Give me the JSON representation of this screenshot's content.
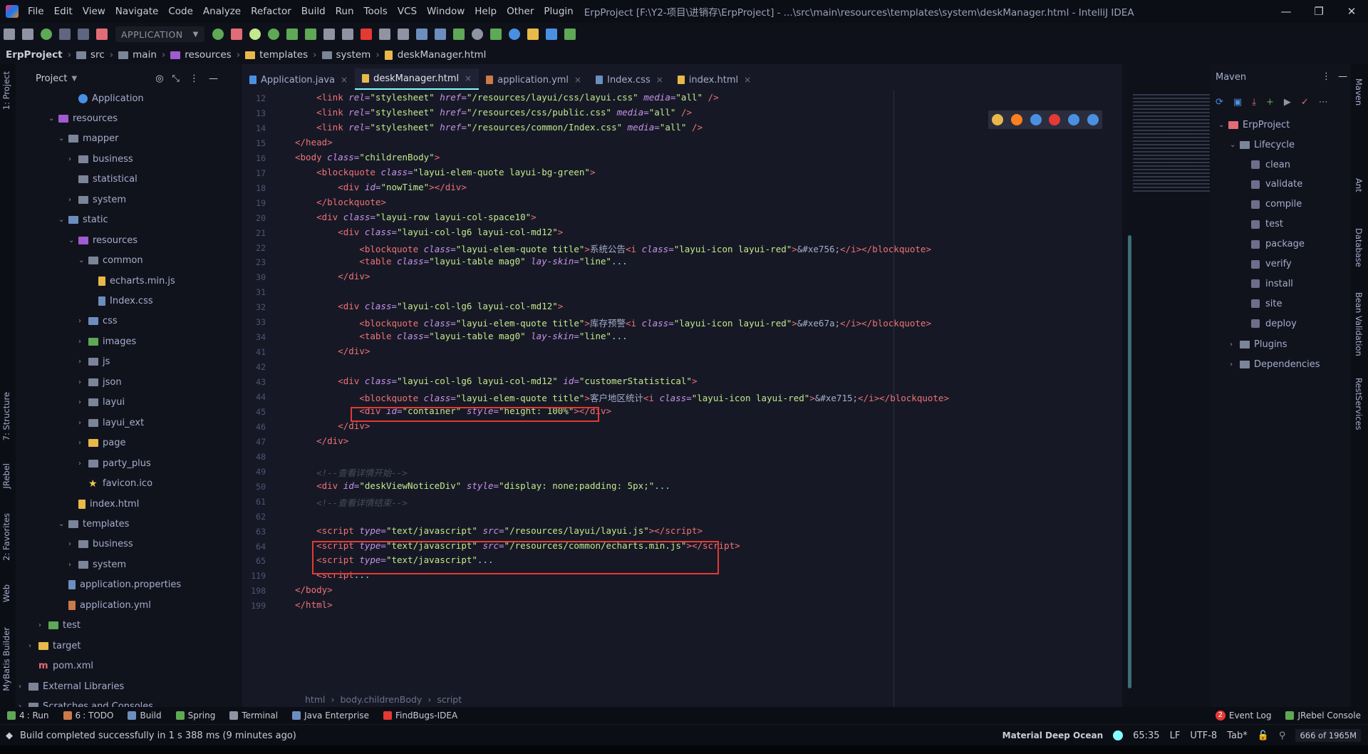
{
  "window": {
    "title": "ErpProject [F:\\Y2-项目\\进销存\\ErpProject] - ...\\src\\main\\resources\\templates\\system\\deskManager.html - IntelliJ IDEA",
    "minimize": "—",
    "maximize": "❐",
    "close": "✕"
  },
  "menu": [
    "File",
    "Edit",
    "View",
    "Navigate",
    "Code",
    "Analyze",
    "Refactor",
    "Build",
    "Run",
    "Tools",
    "VCS",
    "Window",
    "Help",
    "Other",
    "Plugin"
  ],
  "toolbar": {
    "run_config": "APPLICATION"
  },
  "breadcrumb": [
    "ErpProject",
    "src",
    "main",
    "resources",
    "templates",
    "system",
    "deskManager.html"
  ],
  "left_stripe": {
    "project": "1: Project",
    "structure": "7: Structure",
    "jrebel": "JRebel",
    "favorites": "2: Favorites",
    "web": "Web",
    "mybatis": "MyBatis Builder"
  },
  "project_panel": {
    "label": "Project",
    "tree": [
      {
        "label": "Application",
        "icon": "class",
        "indent": 5,
        "arrow": ""
      },
      {
        "label": "resources",
        "icon": "res",
        "indent": 3,
        "arrow": "⌄"
      },
      {
        "label": "mapper",
        "icon": "folder",
        "indent": 4,
        "arrow": "⌄"
      },
      {
        "label": "business",
        "icon": "folder",
        "indent": 5,
        "arrow": "›"
      },
      {
        "label": "statistical",
        "icon": "folder",
        "indent": 5,
        "arrow": ""
      },
      {
        "label": "system",
        "icon": "folder",
        "indent": 5,
        "arrow": "›"
      },
      {
        "label": "static",
        "icon": "src",
        "indent": 4,
        "arrow": "⌄"
      },
      {
        "label": "resources",
        "icon": "res",
        "indent": 5,
        "arrow": "⌄"
      },
      {
        "label": "common",
        "icon": "folder",
        "indent": 6,
        "arrow": "⌄"
      },
      {
        "label": "echarts.min.js",
        "icon": "js",
        "indent": 7,
        "arrow": ""
      },
      {
        "label": "Index.css",
        "icon": "css",
        "indent": 7,
        "arrow": ""
      },
      {
        "label": "css",
        "icon": "src",
        "indent": 6,
        "arrow": "›"
      },
      {
        "label": "images",
        "icon": "test",
        "indent": 6,
        "arrow": "›"
      },
      {
        "label": "js",
        "icon": "folder",
        "indent": 6,
        "arrow": "›"
      },
      {
        "label": "json",
        "icon": "folder",
        "indent": 6,
        "arrow": "›"
      },
      {
        "label": "layui",
        "icon": "folder",
        "indent": 6,
        "arrow": "›"
      },
      {
        "label": "layui_ext",
        "icon": "folder",
        "indent": 6,
        "arrow": "›"
      },
      {
        "label": "page",
        "icon": "page",
        "indent": 6,
        "arrow": "›"
      },
      {
        "label": "party_plus",
        "icon": "folder",
        "indent": 6,
        "arrow": "›"
      },
      {
        "label": "favicon.ico",
        "icon": "star",
        "indent": 6,
        "arrow": ""
      },
      {
        "label": "index.html",
        "icon": "htm",
        "indent": 5,
        "arrow": ""
      },
      {
        "label": "templates",
        "icon": "folder",
        "indent": 4,
        "arrow": "⌄"
      },
      {
        "label": "business",
        "icon": "folder",
        "indent": 5,
        "arrow": "›"
      },
      {
        "label": "system",
        "icon": "folder",
        "indent": 5,
        "arrow": "›"
      },
      {
        "label": "application.properties",
        "icon": "prop",
        "indent": 4,
        "arrow": ""
      },
      {
        "label": "application.yml",
        "icon": "yml",
        "indent": 4,
        "arrow": ""
      },
      {
        "label": "test",
        "icon": "test",
        "indent": 2,
        "arrow": "›"
      },
      {
        "label": "target",
        "icon": "page",
        "indent": 1,
        "arrow": "›"
      },
      {
        "label": "pom.xml",
        "icon": "pom",
        "indent": 1,
        "arrow": ""
      },
      {
        "label": "External Libraries",
        "icon": "lib",
        "indent": 0,
        "arrow": "›"
      },
      {
        "label": "Scratches and Consoles",
        "icon": "lib",
        "indent": 0,
        "arrow": "›"
      }
    ]
  },
  "editor_tabs": [
    {
      "label": "Application.java",
      "color": "#4a90e2",
      "active": false
    },
    {
      "label": "deskManager.html",
      "color": "#e8b94a",
      "active": true
    },
    {
      "label": "application.yml",
      "color": "#cb7a4a",
      "active": false
    },
    {
      "label": "Index.css",
      "color": "#6c8ebf",
      "active": false
    },
    {
      "label": "index.html",
      "color": "#e8b94a",
      "active": false
    }
  ],
  "code_lines": [
    {
      "n": "12",
      "html": "    <span class=\"tag\">&lt;link</span> <span class=\"attr\">rel=</span><span class=\"str\">\"stylesheet\"</span> <span class=\"attr\">href=</span><span class=\"str\">\"/resources/layui/css/layui.css\"</span> <span class=\"attr\">media=</span><span class=\"str\">\"all\"</span> <span class=\"tag\">/&gt;</span>"
    },
    {
      "n": "13",
      "html": "    <span class=\"tag\">&lt;link</span> <span class=\"attr\">rel=</span><span class=\"str\">\"stylesheet\"</span> <span class=\"attr\">href=</span><span class=\"str\">\"/resources/css/public.css\"</span> <span class=\"attr\">media=</span><span class=\"str\">\"all\"</span> <span class=\"tag\">/&gt;</span>"
    },
    {
      "n": "14",
      "html": "    <span class=\"tag\">&lt;link</span> <span class=\"attr\">rel=</span><span class=\"str\">\"stylesheet\"</span> <span class=\"attr\">href=</span><span class=\"str\">\"/resources/common/Index.css\"</span> <span class=\"attr\">media=</span><span class=\"str\">\"all\"</span> <span class=\"tag\">/&gt;</span>"
    },
    {
      "n": "15",
      "html": "<span class=\"tag\">&lt;/head&gt;</span>"
    },
    {
      "n": "16",
      "html": "<span class=\"tag\">&lt;body</span> <span class=\"attr\">class=</span><span class=\"str\">\"childrenBody\"</span><span class=\"tag\">&gt;</span>"
    },
    {
      "n": "17",
      "html": "    <span class=\"tag\">&lt;blockquote</span> <span class=\"attr\">class=</span><span class=\"str\">\"layui-elem-quote layui-bg-green\"</span><span class=\"tag\">&gt;</span>"
    },
    {
      "n": "18",
      "html": "        <span class=\"tag\">&lt;div</span> <span class=\"attr\">id=</span><span class=\"str\">\"nowTime\"</span><span class=\"tag\">&gt;&lt;/div&gt;</span>"
    },
    {
      "n": "19",
      "html": "    <span class=\"tag\">&lt;/blockquote&gt;</span>"
    },
    {
      "n": "20",
      "html": "    <span class=\"tag\">&lt;div</span> <span class=\"attr\">class=</span><span class=\"str\">\"layui-row layui-col-space10\"</span><span class=\"tag\">&gt;</span>"
    },
    {
      "n": "21",
      "html": "        <span class=\"tag\">&lt;div</span> <span class=\"attr\">class=</span><span class=\"str\">\"layui-col-lg6 layui-col-md12\"</span><span class=\"tag\">&gt;</span>"
    },
    {
      "n": "22",
      "html": "            <span class=\"tag\">&lt;blockquote</span> <span class=\"attr\">class=</span><span class=\"str\">\"layui-elem-quote title\"</span><span class=\"tag\">&gt;</span><span class=\"txt\">系统公告</span><span class=\"tag\">&lt;i</span> <span class=\"attr\">class=</span><span class=\"str\">\"layui-icon layui-red\"</span><span class=\"tag\">&gt;</span><span class=\"txt\">&amp;#xe756;</span><span class=\"tag\">&lt;/i&gt;&lt;/blockquote&gt;</span>"
    },
    {
      "n": "23",
      "html": "            <span class=\"tag\">&lt;table</span> <span class=\"attr\">class=</span><span class=\"str\">\"layui-table mag0\"</span> <span class=\"attr\">lay-skin=</span><span class=\"str\">\"line\"</span><span class=\"fold\">...</span>"
    },
    {
      "n": "30",
      "html": "        <span class=\"tag\">&lt;/div&gt;</span>"
    },
    {
      "n": "31",
      "html": ""
    },
    {
      "n": "32",
      "html": "        <span class=\"tag\">&lt;div</span> <span class=\"attr\">class=</span><span class=\"str\">\"layui-col-lg6 layui-col-md12\"</span><span class=\"tag\">&gt;</span>"
    },
    {
      "n": "33",
      "html": "            <span class=\"tag\">&lt;blockquote</span> <span class=\"attr\">class=</span><span class=\"str\">\"layui-elem-quote title\"</span><span class=\"tag\">&gt;</span><span class=\"txt\">库存预警</span><span class=\"tag\">&lt;i</span> <span class=\"attr\">class=</span><span class=\"str\">\"layui-icon layui-red\"</span><span class=\"tag\">&gt;</span><span class=\"txt\">&amp;#xe67a;</span><span class=\"tag\">&lt;/i&gt;&lt;/blockquote&gt;</span>"
    },
    {
      "n": "34",
      "html": "            <span class=\"tag\">&lt;table</span> <span class=\"attr\">class=</span><span class=\"str\">\"layui-table mag0\"</span> <span class=\"attr\">lay-skin=</span><span class=\"str\">\"line\"</span><span class=\"fold\">...</span>"
    },
    {
      "n": "41",
      "html": "        <span class=\"tag\">&lt;/div&gt;</span>"
    },
    {
      "n": "42",
      "html": ""
    },
    {
      "n": "43",
      "html": "        <span class=\"tag\">&lt;div</span> <span class=\"attr\">class=</span><span class=\"str\">\"layui-col-lg6 layui-col-md12\"</span> <span class=\"attr\">id=</span><span class=\"str\">\"customerStatistical\"</span><span class=\"tag\">&gt;</span>"
    },
    {
      "n": "44",
      "html": "            <span class=\"tag\">&lt;blockquote</span> <span class=\"attr\">class=</span><span class=\"str\">\"layui-elem-quote title\"</span><span class=\"tag\">&gt;</span><span class=\"txt\">客户地区统计</span><span class=\"tag\">&lt;i</span> <span class=\"attr\">class=</span><span class=\"str\">\"layui-icon layui-red\"</span><span class=\"tag\">&gt;</span><span class=\"txt\">&amp;#xe715;</span><span class=\"tag\">&lt;/i&gt;&lt;/blockquote&gt;</span>"
    },
    {
      "n": "45",
      "html": "            <span class=\"tag\">&lt;div</span> <span class=\"attr\">id=</span><span class=\"str\">\"container\"</span> <span class=\"attr\">style=</span><span class=\"str\">\"height: 100%\"</span><span class=\"tag\">&gt;&lt;/div&gt;</span>"
    },
    {
      "n": "46",
      "html": "        <span class=\"tag\">&lt;/div&gt;</span>"
    },
    {
      "n": "47",
      "html": "    <span class=\"tag\">&lt;/div&gt;</span>"
    },
    {
      "n": "48",
      "html": ""
    },
    {
      "n": "49",
      "html": "    <span class=\"cmt\">&lt;!--查看详情开始--&gt;</span>"
    },
    {
      "n": "50",
      "html": "    <span class=\"tag\">&lt;div</span> <span class=\"attr\">id=</span><span class=\"str\">\"deskViewNoticeDiv\"</span> <span class=\"attr\">style=</span><span class=\"str\">\"display: none;padding: 5px;\"</span><span class=\"fold\">...</span>"
    },
    {
      "n": "61",
      "html": "    <span class=\"cmt\">&lt;!--查看详情结束--&gt;</span>"
    },
    {
      "n": "62",
      "html": ""
    },
    {
      "n": "63",
      "html": "    <span class=\"tag\">&lt;script</span> <span class=\"attr\">type=</span><span class=\"str\">\"text/javascript\"</span> <span class=\"attr\">src=</span><span class=\"str\">\"/resources/layui/layui.js\"</span><span class=\"tag\">&gt;&lt;/script&gt;</span>"
    },
    {
      "n": "64",
      "html": "    <span class=\"tag\">&lt;script</span> <span class=\"attr\">type=</span><span class=\"str\">\"text/javascript\"</span> <span class=\"attr\">src=</span><span class=\"str\">\"/resources/common/echarts.min.js\"</span><span class=\"tag\">&gt;&lt;/script&gt;</span>"
    },
    {
      "n": "65",
      "html": "    <span class=\"tag\">&lt;script</span> <span class=\"attr\">type=</span><span class=\"str\">\"text/javascript\"</span><span class=\"fold\">...</span>"
    },
    {
      "n": "119",
      "html": "    <span class=\"tag\">&lt;script</span><span class=\"fold\">...</span>"
    },
    {
      "n": "198",
      "html": "<span class=\"tag\">&lt;/body&gt;</span>"
    },
    {
      "n": "199",
      "html": "<span class=\"tag\">&lt;/html&gt;</span>"
    }
  ],
  "editor_crumbs": [
    "html",
    "body.childrenBody",
    "script"
  ],
  "maven": {
    "title": "Maven",
    "project": "ErpProject",
    "lifecycle": "Lifecycle",
    "goals": [
      "clean",
      "validate",
      "compile",
      "test",
      "package",
      "verify",
      "install",
      "site",
      "deploy"
    ],
    "plugins": "Plugins",
    "dependencies": "Dependencies"
  },
  "right_stripe": [
    "Maven",
    "Ant",
    "Database",
    "Bean Validation",
    "RestServices"
  ],
  "bottom_tools": [
    {
      "n": "4",
      "label": ": Run",
      "color": "#5fa855"
    },
    {
      "n": "6",
      "label": ": TODO",
      "color": "#cb7a4a"
    },
    {
      "n": "",
      "label": "Build",
      "color": "#6c8ebf"
    },
    {
      "n": "",
      "label": "Spring",
      "color": "#5fa855"
    },
    {
      "n": "",
      "label": "Terminal",
      "color": "#8f93a2"
    },
    {
      "n": "",
      "label": "Java Enterprise",
      "color": "#6c8ebf"
    },
    {
      "n": "",
      "label": "FindBugs-IDEA",
      "color": "#e53935"
    }
  ],
  "bottom_right_tools": {
    "event_log": "Event Log",
    "event_count": "2",
    "jrebel_console": "JRebel Console"
  },
  "status": {
    "message": "Build completed successfully in 1 s 388 ms (9 minutes ago)",
    "theme": "Material Deep Ocean",
    "position": "65:35",
    "line_sep": "LF",
    "encoding": "UTF-8",
    "indent": "Tab*",
    "memory": "666 of 1965M"
  },
  "colors": {
    "accent": "#84ffff",
    "highlight_box": "#e53935",
    "background": "#0f111a"
  }
}
